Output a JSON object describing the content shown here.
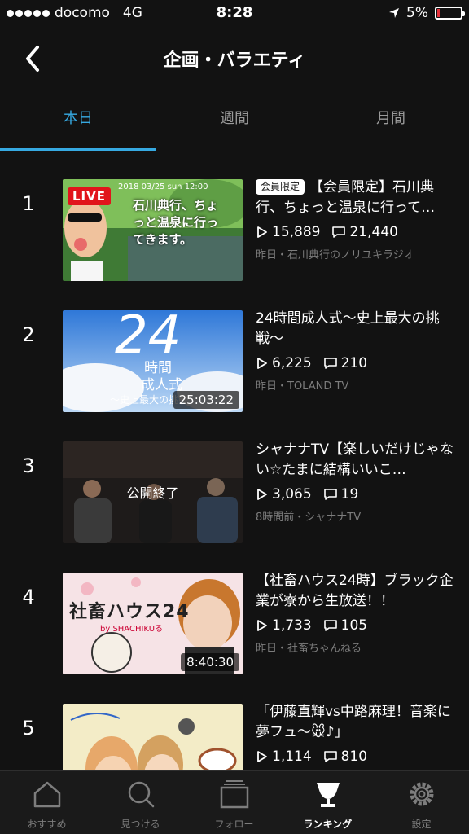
{
  "status_bar": {
    "carrier": "docomo",
    "network": "4G",
    "time": "8:28",
    "battery": "5%"
  },
  "header": {
    "title": "企画・バラエティ"
  },
  "tabs": [
    {
      "label": "本日",
      "active": true
    },
    {
      "label": "週間",
      "active": false
    },
    {
      "label": "月間",
      "active": false
    }
  ],
  "videos": [
    {
      "rank": "1",
      "badge": "会員限定",
      "title": "【会員限定】石川典行、ちょっと温泉に行って…",
      "views": "15,889",
      "comments": "21,440",
      "meta": "昨日・石川典行のノリユキラジオ",
      "overlay": "LIVE",
      "thumb_text": "石川典行、ちょっと温泉に行ってきます。",
      "thumb_date": "2018 03/25 sun 12:00"
    },
    {
      "rank": "2",
      "title": "24時間成人式〜史上最大の挑戦〜",
      "views": "6,225",
      "comments": "210",
      "meta": "昨日・TOLAND TV",
      "duration": "25:03:22",
      "thumb_text_big": "24",
      "thumb_text_a": "時間",
      "thumb_text_b": "成人式",
      "thumb_text_c": "〜史上最大の挑戦〜"
    },
    {
      "rank": "3",
      "title": "シャナナTV【楽しいだけじゃない☆たまに結構いいこ…",
      "views": "3,065",
      "comments": "19",
      "meta": "8時間前・シャナナTV",
      "overlay": "公開終了"
    },
    {
      "rank": "4",
      "title": "【社畜ハウス24時】ブラック企業が寮から生放送！！",
      "views": "1,733",
      "comments": "105",
      "meta": "昨日・社畜ちゃんねる",
      "duration": "8:40:30",
      "thumb_text": "社畜ハウス24",
      "thumb_sub": "by SHACHIKUる"
    },
    {
      "rank": "5",
      "title": "「伊藤直輝vs中路麻理！音楽に夢フュ〜🐭♪」",
      "views": "1,114",
      "comments": "810",
      "meta": ""
    }
  ],
  "bottom_nav": [
    {
      "label": "おすすめ",
      "icon": "home-icon",
      "active": false
    },
    {
      "label": "見つける",
      "icon": "search-icon",
      "active": false
    },
    {
      "label": "フォロー",
      "icon": "follow-icon",
      "active": false
    },
    {
      "label": "ランキング",
      "icon": "trophy-icon",
      "active": true
    },
    {
      "label": "設定",
      "icon": "gear-icon",
      "active": false
    }
  ],
  "colors": {
    "accent": "#36a9e1",
    "background": "#121212",
    "live": "#e1141b"
  }
}
